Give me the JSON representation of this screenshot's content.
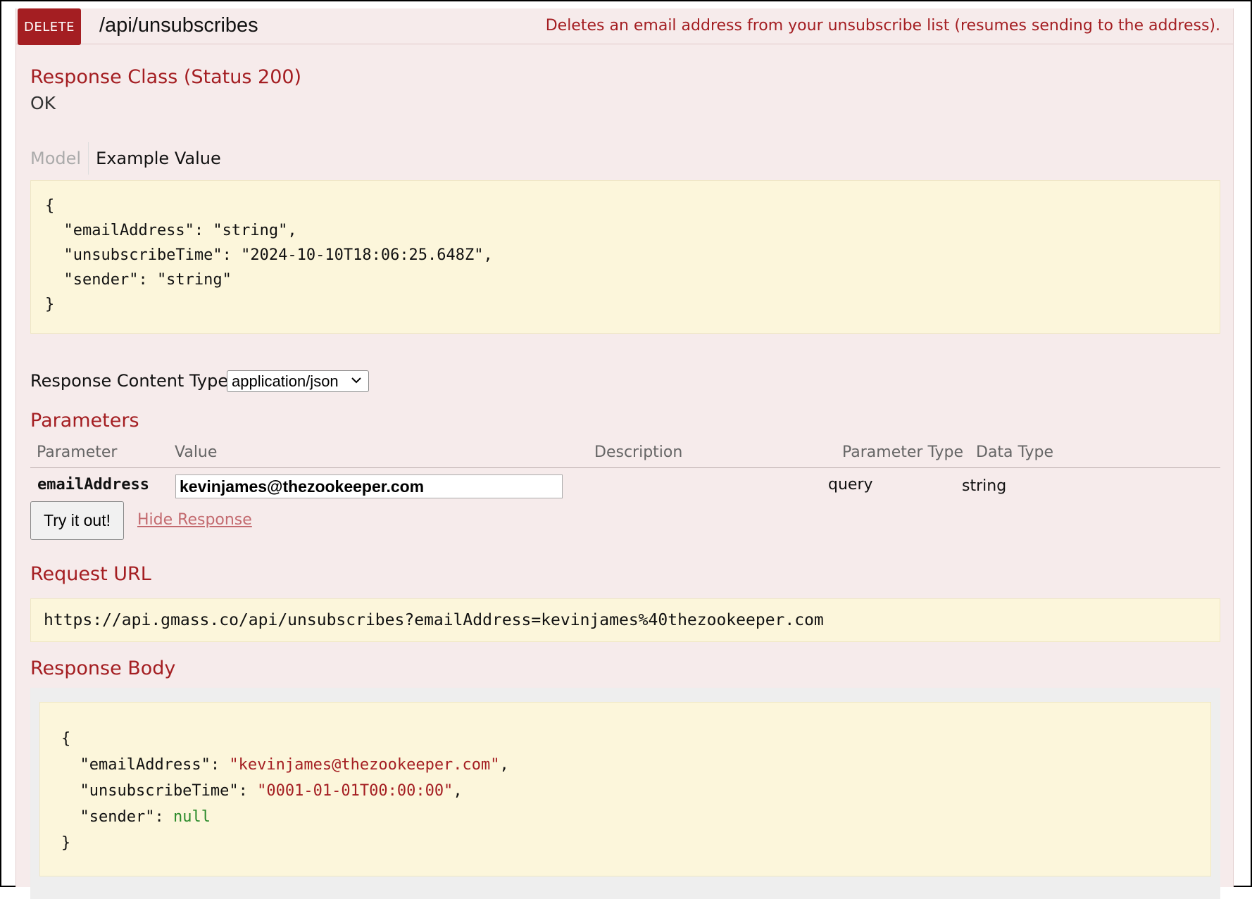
{
  "operation": {
    "method": "DELETE",
    "path": "/api/unsubscribes",
    "summary": "Deletes an email address from your unsubscribe list (resumes sending to the address)."
  },
  "response_class": {
    "title": "Response Class (Status 200)",
    "status_text": "OK",
    "tabs": {
      "model": "Model",
      "example": "Example Value"
    },
    "example_lines": [
      "{",
      "  \"emailAddress\": \"string\",",
      "  \"unsubscribeTime\": \"2024-10-10T18:06:25.648Z\",",
      "  \"sender\": \"string\"",
      "}"
    ]
  },
  "response_content_type": {
    "label": "Response Content Type",
    "selected": "application/json"
  },
  "parameters": {
    "title": "Parameters",
    "headers": [
      "Parameter",
      "Value",
      "Description",
      "Parameter Type",
      "Data Type"
    ],
    "rows": [
      {
        "name": "emailAddress",
        "value": "kevinjames@thezookeeper.com",
        "description": "",
        "param_type": "query",
        "data_type": "string"
      }
    ]
  },
  "actions": {
    "try_button": "Try it out!",
    "hide_link": "Hide Response"
  },
  "request_url": {
    "title": "Request URL",
    "value": "https://api.gmass.co/api/unsubscribes?emailAddress=kevinjames%40thezookeeper.com"
  },
  "response_body": {
    "title": "Response Body",
    "open": "{",
    "close": "}",
    "fields": [
      {
        "key": "\"emailAddress\"",
        "value": "\"kevinjames@thezookeeper.com\"",
        "kind": "string",
        "comma": ","
      },
      {
        "key": "\"unsubscribeTime\"",
        "value": "\"0001-01-01T00:00:00\"",
        "kind": "string",
        "comma": ","
      },
      {
        "key": "\"sender\"",
        "value": "null",
        "kind": "null",
        "comma": ""
      }
    ]
  },
  "colors": {
    "accent": "#a41e22",
    "panel_bg": "#f6ebeb",
    "code_bg": "#fcf6db",
    "null_green": "#2a8a2a",
    "link": "#c36a6f"
  },
  "icons": {
    "select_caret": "chevron-down-icon"
  }
}
